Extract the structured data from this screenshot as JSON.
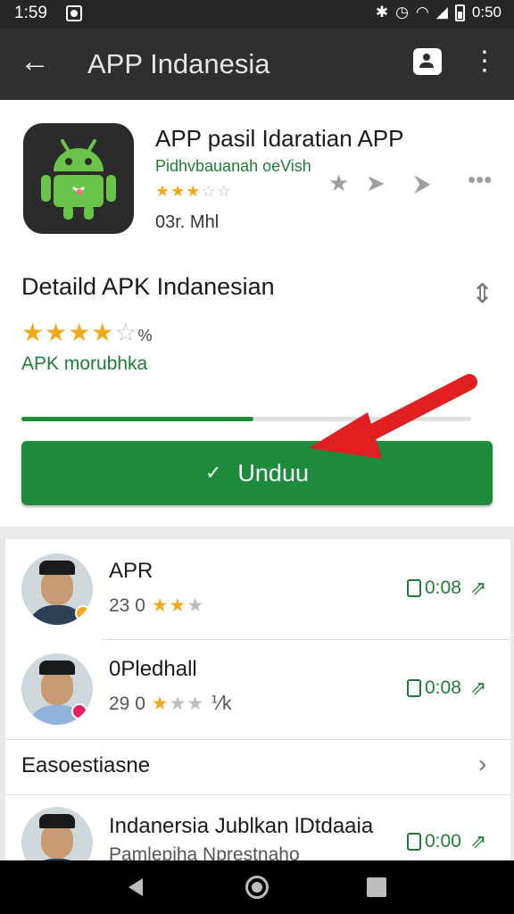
{
  "status_bar": {
    "time": "1:59",
    "clock": "0:50",
    "icons": [
      "notification-icon",
      "bluetooth-icon",
      "alarm-icon",
      "wifi-icon",
      "signal-icon",
      "battery-icon"
    ]
  },
  "app_bar": {
    "title": "APP Indanesia",
    "back_icon": "arrow-left-icon",
    "account_icon": "account-icon",
    "more_icon": "more-vert-icon"
  },
  "app_header": {
    "name": "APP pasil Idaratian APP",
    "developer": "Pidhvbauanah oeVish",
    "rating_stars": 3,
    "rating_max": 5,
    "size": "03r. Mhl",
    "actions": [
      "star-icon",
      "send-icon",
      "share-icon",
      "more-horiz-icon"
    ]
  },
  "detail": {
    "title": "Detaild APK Indanesian",
    "rating_stars": 4,
    "rating_max": 5,
    "rating_suffix": "%",
    "subtitle": "APK morubhka",
    "progress_fraction": 0.516
  },
  "download_button": {
    "label": "Unduu",
    "icon": "check-icon"
  },
  "list": {
    "items": [
      {
        "name": "APR",
        "count": "23 0",
        "stars": 2,
        "stars_max": 3,
        "suffix": "",
        "action_text": "0:08",
        "badge_color": "#f5a623"
      },
      {
        "name": "0Pledhall",
        "count": "29 0",
        "stars": 1,
        "stars_max": 3,
        "suffix": "⅟k",
        "action_text": "0:08",
        "badge_color": "#e91e63"
      }
    ],
    "section_label": "Easoestiasne",
    "last_item": {
      "name": "Indanersia Jublkan lDtdaaia",
      "meta": "Pamlepiha Nprestnaho",
      "action_text": "0:00"
    }
  },
  "nav_bar": {
    "buttons": [
      "back-nav-icon",
      "home-nav-icon",
      "recents-nav-icon"
    ]
  },
  "colors": {
    "accent_green": "#1e8a3c",
    "star": "#f0a81c",
    "toolbar": "#2f2f2f",
    "arrow_red": "#e02020"
  }
}
